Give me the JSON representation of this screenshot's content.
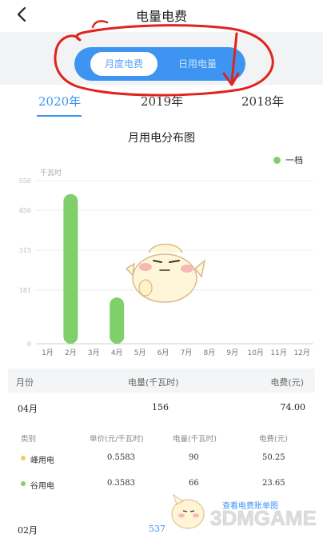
{
  "header": {
    "title": "电量电费",
    "back_icon": "chevron-left-icon"
  },
  "segment": {
    "options": [
      {
        "label": "月度电费",
        "selected": true
      },
      {
        "label": "日用电量",
        "selected": false
      }
    ],
    "accent": "#3d95f1"
  },
  "years": {
    "items": [
      "2020年",
      "2019年",
      "2018年"
    ],
    "selected": "2020年"
  },
  "chart_data": {
    "type": "bar",
    "title": "月用电分布图",
    "ylabel": "千瓦时",
    "yticks": [
      "550",
      "450",
      "315",
      "181",
      "0"
    ],
    "ytick_values": [
      550,
      450,
      315,
      181,
      0
    ],
    "ylim": [
      0,
      550
    ],
    "categories": [
      "1月",
      "2月",
      "3月",
      "4月",
      "5月",
      "6月",
      "7月",
      "8月",
      "9月",
      "10月",
      "11月",
      "12月"
    ],
    "series": [
      {
        "name": "一档",
        "color": "#7fd06b",
        "values": [
          0,
          505,
          0,
          156,
          0,
          0,
          0,
          0,
          0,
          0,
          0,
          0
        ]
      }
    ],
    "grid": true,
    "legend": "top-right"
  },
  "table": {
    "headers": [
      "月份",
      "电量(千瓦时)",
      "电费(元)"
    ],
    "rows": [
      {
        "month": "04月",
        "usage": "156",
        "fee": "74.00"
      },
      {
        "month": "02月",
        "usage": "537",
        "fee": ""
      }
    ],
    "detail_headers": [
      "类别",
      "单价(元/千瓦时)",
      "电量(千瓦时)",
      "电费(元)"
    ],
    "details": [
      {
        "type": "峰用电",
        "dot_color": "#f3cf63",
        "price": "0.5583",
        "usage": "90",
        "fee": "50.25"
      },
      {
        "type": "谷用电",
        "dot_color": "#7fd06b",
        "price": "0.3583",
        "usage": "66",
        "fee": "23.65"
      }
    ],
    "bill_link": "查看电费账单图"
  },
  "watermark": {
    "text": "3DMGAME"
  }
}
